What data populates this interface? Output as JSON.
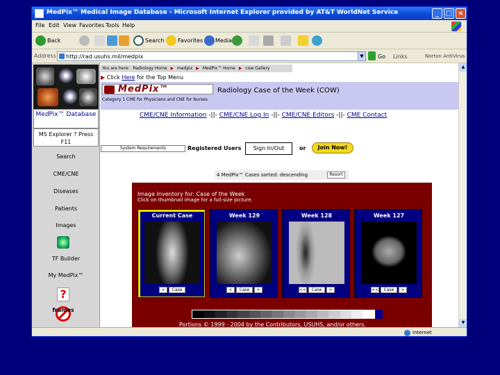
{
  "window": {
    "title": "MedPix™ Medical Image Database - Microsoft Internet Explorer provided by AT&T WorldNet Service",
    "controls": {
      "minimize": "_",
      "maximize": "□",
      "close": "×"
    }
  },
  "menu": [
    "File",
    "Edit",
    "View",
    "Favorites",
    "Tools",
    "Help"
  ],
  "toolbar": {
    "back": "Back",
    "search": "Search",
    "favorites": "Favorites",
    "media": "Media"
  },
  "address": {
    "label": "Address",
    "url": "http://rad.usuhs.mil/medpix",
    "go": "Go",
    "links": "Links",
    "norton": "Norton AntiVirus"
  },
  "leftnav": {
    "db_title": "MedPix™ Database",
    "ms_explorer": "MS Explorer ? Press F11",
    "items": [
      "Search",
      "CME/CNE",
      "Diseases",
      "Patients",
      "Images",
      "TF Builder",
      "My MedPix™"
    ],
    "noframes": "frames"
  },
  "main": {
    "breadcrumb": {
      "prefix": "You are here:",
      "items": [
        "Radiology Home",
        "medpix",
        "MedPix™ Home",
        "cow Gallery"
      ]
    },
    "top_menu": {
      "pre": "Click",
      "link": "Here",
      "post": "for the Top Menu"
    },
    "logo_text": "MedPix™",
    "cow_title": "Radiology Case of the Week (COW)",
    "category": "Category 1 CME for Physicians and CNE for Nurses",
    "cme_links": [
      "CME/CNE Information",
      "CME/CNE Log In",
      "CME/CNE Editors",
      "CME Contact"
    ],
    "cme_sep": " -||- ",
    "system_requirements": "System Requirements",
    "registered_users": "Registered Users",
    "sign_in": "Sign In/Out",
    "or": "or",
    "join": "Join Now!",
    "cases_count": "4 MedPix™ Cases",
    "cases_sort": "sorted: descending",
    "sort_btn": "Resort",
    "inventory_title": "Image Inventory for: Case of the Week",
    "inventory_sub": "Click on thumbnail image for a full-size picture.",
    "cases": [
      {
        "label": "Current Case",
        "ctrls": [
          "<",
          "Case"
        ]
      },
      {
        "label": "Week 129",
        "ctrls": [
          "<",
          "Case",
          ">"
        ]
      },
      {
        "label": "Week 128",
        "ctrls": [
          "<<",
          "Case",
          ">"
        ]
      },
      {
        "label": "Week 127",
        "ctrls": [
          "<<",
          "Case",
          ">"
        ]
      }
    ],
    "portions": "Portions © 1999 - 2004 by the Contributors, USUHS, and/or others."
  },
  "status": {
    "zone": "Internet"
  }
}
